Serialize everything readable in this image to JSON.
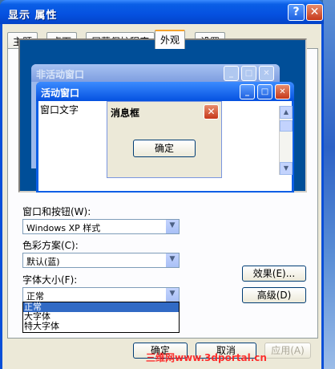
{
  "window": {
    "title": "显示 属性",
    "help_label": "?",
    "close_label": "✕"
  },
  "tabs": [
    {
      "label": "主题"
    },
    {
      "label": "桌面"
    },
    {
      "label": "屏幕保护程序"
    },
    {
      "label": "外观"
    },
    {
      "label": "设置"
    }
  ],
  "preview": {
    "inactive_title": "非活动窗口",
    "active_title": "活动窗口",
    "window_text": "窗口文字",
    "msgbox_title": "消息框",
    "msgbox_ok": "确定"
  },
  "form": {
    "windows_buttons_label": "窗口和按钮(W):",
    "windows_buttons_value": "Windows XP 样式",
    "color_scheme_label": "色彩方案(C):",
    "color_scheme_value": "默认(蓝)",
    "font_size_label": "字体大小(F):",
    "font_size_value": "正常",
    "font_size_options": [
      "正常",
      "大字体",
      "特大字体"
    ]
  },
  "buttons": {
    "effects": "效果(E)...",
    "advanced": "高级(D)",
    "ok": "确定",
    "cancel": "取消",
    "apply": "应用(A)"
  },
  "watermark": "三维网www.3dportal.cn",
  "colors": {
    "titlebar": "#0551e0",
    "desktop_preview": "#004e98",
    "dialog_face": "#ece9d8",
    "selection": "#316ac5",
    "active_tab_accent": "#f5a32d"
  }
}
